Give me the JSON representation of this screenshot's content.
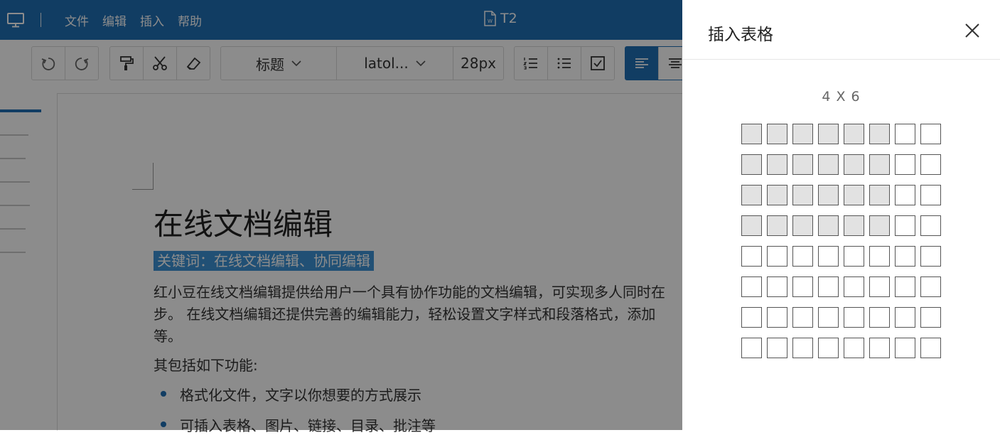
{
  "header": {
    "menu": [
      "文件",
      "编辑",
      "插入",
      "帮助"
    ],
    "doc_title": "T2",
    "monitor_icon": "monitor-icon",
    "doc_icon": "word-doc-icon"
  },
  "toolbar": {
    "history": [
      "undo-icon",
      "redo-icon"
    ],
    "format": [
      "format-painter-icon",
      "scissors-icon",
      "eraser-icon"
    ],
    "style_select": "标题",
    "font_select": "latol...",
    "font_size": "28px",
    "lists": [
      "ordered-list-icon",
      "unordered-list-icon",
      "checklist-icon"
    ],
    "align": [
      "align-left-icon",
      "align-center-icon"
    ]
  },
  "document": {
    "title": "在线文档编辑",
    "keywords": "关键词：在线文档编辑、协同编辑",
    "paragraph_lines": [
      "红小豆在线文档编辑提供给用户一个具有协作功能的文档编辑，可实现多人同时在",
      "步。 在线文档编辑还提供完善的编辑能力，轻松设置文字样式和段落格式，添加",
      "等。"
    ],
    "subheading": "其包括如下功能:",
    "bullets": [
      "格式化文件，文字以你想要的方式展示",
      "可插入表格、图片、链接、目录、批注等"
    ]
  },
  "drawer": {
    "title": "插入表格",
    "close_icon": "close-icon",
    "size_label": "4 X 6",
    "grid": {
      "rows": 8,
      "cols": 8,
      "selected_rows": 4,
      "selected_cols": 6
    }
  },
  "colors": {
    "brand": "#1f6fb5",
    "keyword_highlight": "#3d93d6",
    "selected_cell": "#e2e2e2"
  }
}
